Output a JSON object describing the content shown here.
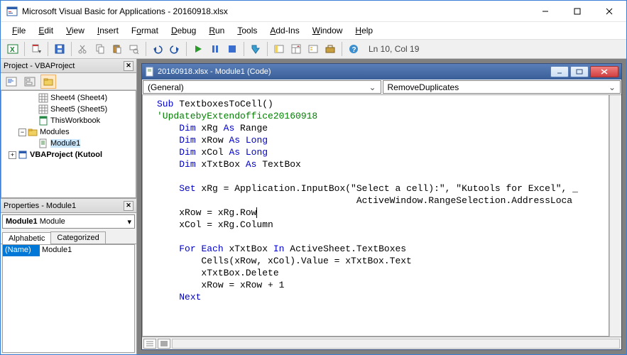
{
  "app": {
    "title": "Microsoft Visual Basic for Applications - 20160918.xlsx"
  },
  "menu": {
    "file": "File",
    "edit": "Edit",
    "view": "View",
    "insert": "Insert",
    "format": "Format",
    "debug": "Debug",
    "run": "Run",
    "tools": "Tools",
    "addins": "Add-Ins",
    "window": "Window",
    "help": "Help"
  },
  "toolbar": {
    "status": "Ln 10, Col 19"
  },
  "project_panel": {
    "title": "Project - VBAProject",
    "tree": {
      "sheet4": "Sheet4 (Sheet4)",
      "sheet5": "Sheet5 (Sheet5)",
      "thiswb": "ThisWorkbook",
      "modules": "Modules",
      "module1": "Module1",
      "vbaproj2": "VBAProject (Kutool"
    }
  },
  "properties_panel": {
    "title": "Properties - Module1",
    "combo_name": "Module1",
    "combo_type": "Module",
    "tabs": {
      "alpha": "Alphabetic",
      "cat": "Categorized"
    },
    "rows": [
      {
        "k": "(Name)",
        "v": "Module1"
      }
    ]
  },
  "mdi": {
    "title": "20160918.xlsx - Module1 (Code)",
    "object_combo": "(General)",
    "proc_combo": "RemoveDuplicates",
    "code_lines": [
      {
        "t": "Sub",
        "kw": true
      },
      {
        "t": " TextboxesToCell()"
      },
      {
        "br": true
      },
      {
        "t": "'UpdatebyExtendoffice20160918",
        "cm": true
      },
      {
        "br": true
      },
      {
        "t": "    "
      },
      {
        "t": "Dim",
        "kw": true
      },
      {
        "t": " xRg "
      },
      {
        "t": "As",
        "kw": true
      },
      {
        "t": " Range"
      },
      {
        "br": true
      },
      {
        "t": "    "
      },
      {
        "t": "Dim",
        "kw": true
      },
      {
        "t": " xRow "
      },
      {
        "t": "As",
        "kw": true
      },
      {
        "t": " "
      },
      {
        "t": "Long",
        "kw": true
      },
      {
        "br": true
      },
      {
        "t": "    "
      },
      {
        "t": "Dim",
        "kw": true
      },
      {
        "t": " xCol "
      },
      {
        "t": "As",
        "kw": true
      },
      {
        "t": " "
      },
      {
        "t": "Long",
        "kw": true
      },
      {
        "br": true
      },
      {
        "t": "    "
      },
      {
        "t": "Dim",
        "kw": true
      },
      {
        "t": " xTxtBox "
      },
      {
        "t": "As",
        "kw": true
      },
      {
        "t": " TextBox"
      },
      {
        "br": true
      },
      {
        "t": " "
      },
      {
        "br": true
      },
      {
        "t": "    "
      },
      {
        "t": "Set",
        "kw": true
      },
      {
        "t": " xRg = Application.InputBox(\"Select a cell):\", \"Kutools for Excel\", _"
      },
      {
        "br": true
      },
      {
        "t": "                                    ActiveWindow.RangeSelection.AddressLoca"
      },
      {
        "br": true
      },
      {
        "t": "    xRow = xRg.Row"
      },
      {
        "cursor": true
      },
      {
        "br": true
      },
      {
        "t": "    xCol = xRg.Column"
      },
      {
        "br": true
      },
      {
        "t": " "
      },
      {
        "br": true
      },
      {
        "t": "    "
      },
      {
        "t": "For",
        "kw": true
      },
      {
        "t": " "
      },
      {
        "t": "Each",
        "kw": true
      },
      {
        "t": " xTxtBox "
      },
      {
        "t": "In",
        "kw": true
      },
      {
        "t": " ActiveSheet.TextBoxes"
      },
      {
        "br": true
      },
      {
        "t": "        Cells(xRow, xCol).Value = xTxtBox.Text"
      },
      {
        "br": true
      },
      {
        "t": "        xTxtBox.Delete"
      },
      {
        "br": true
      },
      {
        "t": "        xRow = xRow + 1"
      },
      {
        "br": true
      },
      {
        "t": "    "
      },
      {
        "t": "Next",
        "kw": true
      }
    ]
  }
}
